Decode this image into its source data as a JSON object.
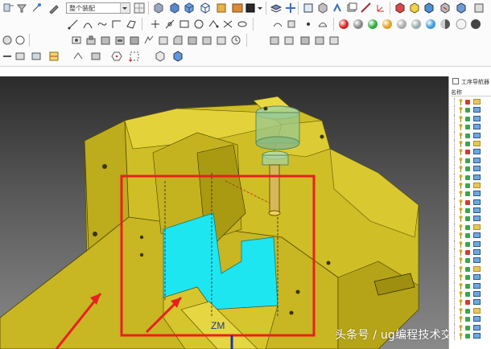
{
  "toolbar": {
    "view_combo_value": "整个装配",
    "row1_icons": [
      "constraint-icon",
      "select-filter-icon",
      "snap-point-icon",
      "pen-icon",
      "view-orient-icon",
      "render-style-icon",
      "cube-view-icon",
      "shaded-cube-icon",
      "wireframe-cube-icon",
      "section-view-icon",
      "color-swatch-icon",
      "black-square-icon",
      "dropdown-arrow-icon",
      "layer-icon",
      "move-icon",
      "axis-icon",
      "orient-cube-icon",
      "copy-icon",
      "stack-icon",
      "measure-icon",
      "wcs-icon",
      "clipboard-icon",
      "analysis-icon",
      "display-icon",
      "hide-icon",
      "show-icon"
    ],
    "row2_icons": [
      "line-icon",
      "arc-icon",
      "spline-icon",
      "point-icon",
      "corner-icon",
      "plane-icon",
      "sketch-icon",
      "circle-icon",
      "pattern-icon",
      "trim-icon",
      "dot-icon",
      "red-ball-icon",
      "grey-ball-icon",
      "green-ball-icon",
      "yellow-ball-icon",
      "lightgrey-ball-icon",
      "glossy-ball-icon",
      "chrome-ball-icon",
      "half-ball-icon"
    ],
    "row3_icons": [
      "sphere-icon",
      "ring-icon",
      "hole-icon",
      "boss-icon",
      "pocket-icon",
      "slot-icon",
      "groove-icon",
      "emboss-icon",
      "pad-icon",
      "chamfer-icon",
      "blend-icon",
      "draft-icon",
      "shell-icon",
      "offset-icon",
      "extract-icon",
      "sew-icon",
      "refresh-icon",
      "clock-icon"
    ],
    "row4_icons": [
      "minus-icon",
      "assembly-icon",
      "add-component-icon",
      "move-component-icon",
      "mate-icon",
      "hexagon-icon",
      "selection-box-icon",
      "box-icon",
      "solid-cube-icon"
    ]
  },
  "viewport": {
    "annotation_color": "#e8201f",
    "model_color": "#d8c830",
    "cavity_color": "#1ee6f0",
    "axis_label": "ZM"
  },
  "navigator": {
    "title": "工序导航器",
    "column_name": "名称",
    "rows": 29
  },
  "watermark": "头条号 / ug编程技术交流"
}
